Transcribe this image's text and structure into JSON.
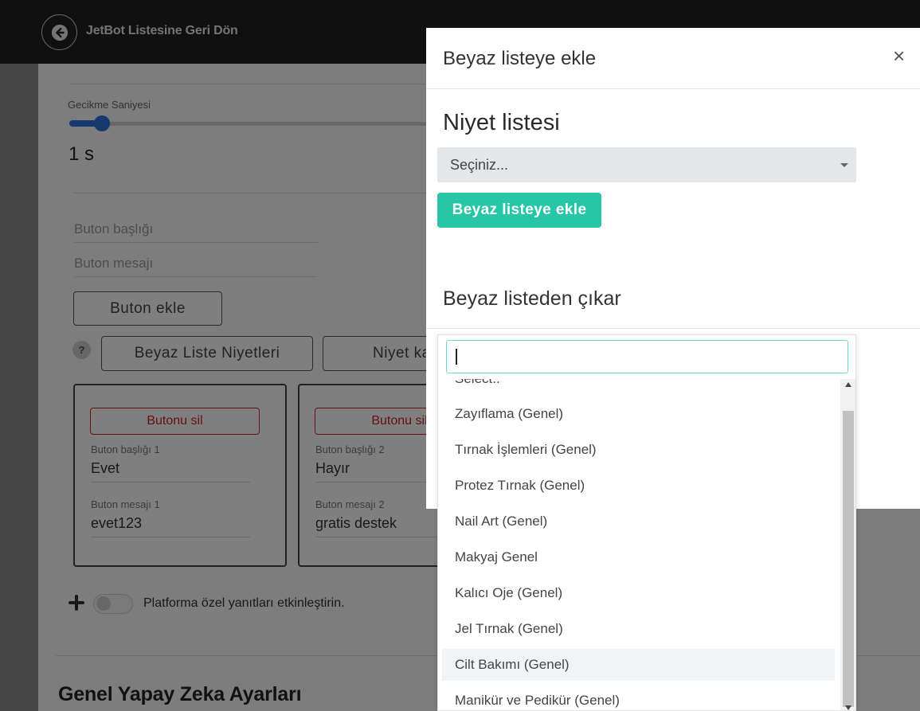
{
  "topbar": {
    "back_label": "JetBot Listesine Geri Dön"
  },
  "settings": {
    "delay_label": "Gecikme Saniyesi",
    "delay_value": "1 s",
    "delay_slider_fraction": 0.08,
    "button_title_placeholder": "Buton başlığı",
    "button_message_placeholder": "Buton mesajı",
    "add_button_label": "Buton ekle",
    "help_badge": "?",
    "whitelist_intents_label": "Beyaz Liste Niyetleri",
    "intent_other_label": "Niyet ka"
  },
  "cards": [
    {
      "delete_label": "Butonu sil",
      "title_label": "Buton başlığı 1",
      "title_value": "Evet",
      "message_label": "Buton mesajı 1",
      "message_value": "evet123"
    },
    {
      "delete_label": "Butonu sil",
      "title_label": "Buton başlığı 2",
      "title_value": "Hayır",
      "message_label": "Buton mesajı 2",
      "message_value": "gratis destek"
    }
  ],
  "platform_toggle": {
    "label": "Platforma özel yanıtları etkinleştirin.",
    "enabled": false
  },
  "section_title": "Genel Yapay Zeka Ayarları",
  "modal": {
    "title": "Beyaz listeye ekle",
    "close_glyph": "×",
    "intent_list_title": "Niyet listesi",
    "select_value": "Seçiniz...",
    "add_button": "Beyaz listeye ekle",
    "remove_title": "Beyaz listeden çıkar"
  },
  "dropdown": {
    "search_value": "",
    "options": [
      "Select..",
      "Zayıflama (Genel)",
      "Tırnak İşlemleri (Genel)",
      "Protez Tırnak (Genel)",
      "Nail Art (Genel)",
      "Makyaj Genel",
      "Kalıcı Oje (Genel)",
      "Jel Tırnak (Genel)",
      "Cilt Bakımı (Genel)",
      "Manikür ve Pedikür (Genel)"
    ],
    "highlighted": "Cilt Bakımı (Genel)"
  }
}
